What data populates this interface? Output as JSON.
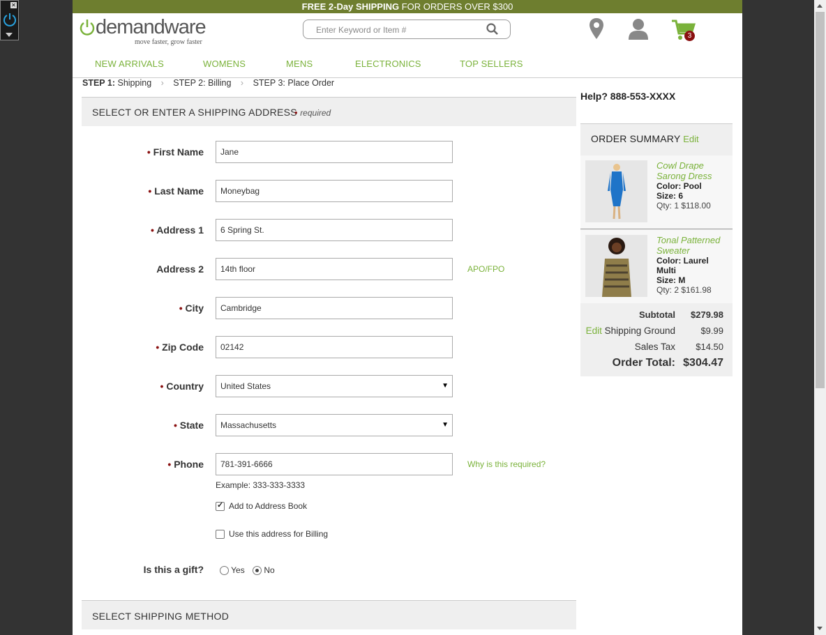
{
  "colors": {
    "accent": "#7ab23a",
    "promo_bg": "#6e7e2f",
    "required": "#8a1010",
    "panel": "#efefef"
  },
  "promo": {
    "bold1": "FREE 2-Day SHIPPING",
    "rest": " FOR ORDERS OVER $300"
  },
  "logo": {
    "brand": "demandware",
    "tagline": "move faster, grow faster"
  },
  "search": {
    "placeholder": "Enter Keyword or Item #"
  },
  "header": {
    "cart_count": "3",
    "icons": [
      "location-icon",
      "user-icon",
      "cart-icon"
    ]
  },
  "nav": [
    "NEW ARRIVALS",
    "WOMENS",
    "MENS",
    "ELECTRONICS",
    "TOP SELLERS"
  ],
  "steps": {
    "s1_bold": "STEP 1:",
    "s1": " Shipping",
    "s2": "STEP 2: Billing",
    "s3": "STEP 3: Place Order"
  },
  "shipping": {
    "title": "SELECT OR ENTER A SHIPPING ADDRESS",
    "required_note": "required",
    "fields": {
      "first_name": {
        "label": "First Name",
        "value": "Jane"
      },
      "last_name": {
        "label": "Last Name",
        "value": "Moneybag"
      },
      "address1": {
        "label": "Address 1",
        "value": "6 Spring St."
      },
      "address2": {
        "label": "Address 2",
        "value": "14th floor",
        "side": "APO/FPO"
      },
      "city": {
        "label": "City",
        "value": "Cambridge"
      },
      "zip": {
        "label": "Zip Code",
        "value": "02142"
      },
      "country": {
        "label": "Country",
        "value": "United States"
      },
      "state": {
        "label": "State",
        "value": "Massachusetts"
      },
      "phone": {
        "label": "Phone",
        "value": "781-391-6666",
        "side": "Why is this required?"
      }
    },
    "phone_example": "Example: 333-333-3333",
    "add_to_book": {
      "label": "Add to Address Book",
      "checked": true
    },
    "use_for_billing": {
      "label": "Use this address for Billing",
      "checked": false
    },
    "gift": {
      "label": "Is this a gift?",
      "yes": "Yes",
      "no": "No",
      "selected": "No"
    }
  },
  "shipping_method": {
    "title": "SELECT SHIPPING METHOD"
  },
  "help": "Help? 888-553-XXXX",
  "summary": {
    "title": "ORDER SUMMARY",
    "edit": "Edit",
    "items": [
      {
        "name": "Cowl Drape Sarong Dress",
        "color": "Color: Pool",
        "size": "Size: 6",
        "qty": "Qty: 1 $118.00"
      },
      {
        "name": "Tonal Patterned Sweater",
        "color": "Color: Laurel Multi",
        "size": "Size: M",
        "qty": "Qty: 2 $161.98"
      }
    ],
    "subtotal_label": "Subtotal",
    "subtotal": "$279.98",
    "shipping_edit": "Edit",
    "shipping_label": "Shipping Ground",
    "shipping": "$9.99",
    "tax_label": "Sales Tax",
    "tax": "$14.50",
    "total_label": "Order Total:",
    "total": "$304.47"
  }
}
